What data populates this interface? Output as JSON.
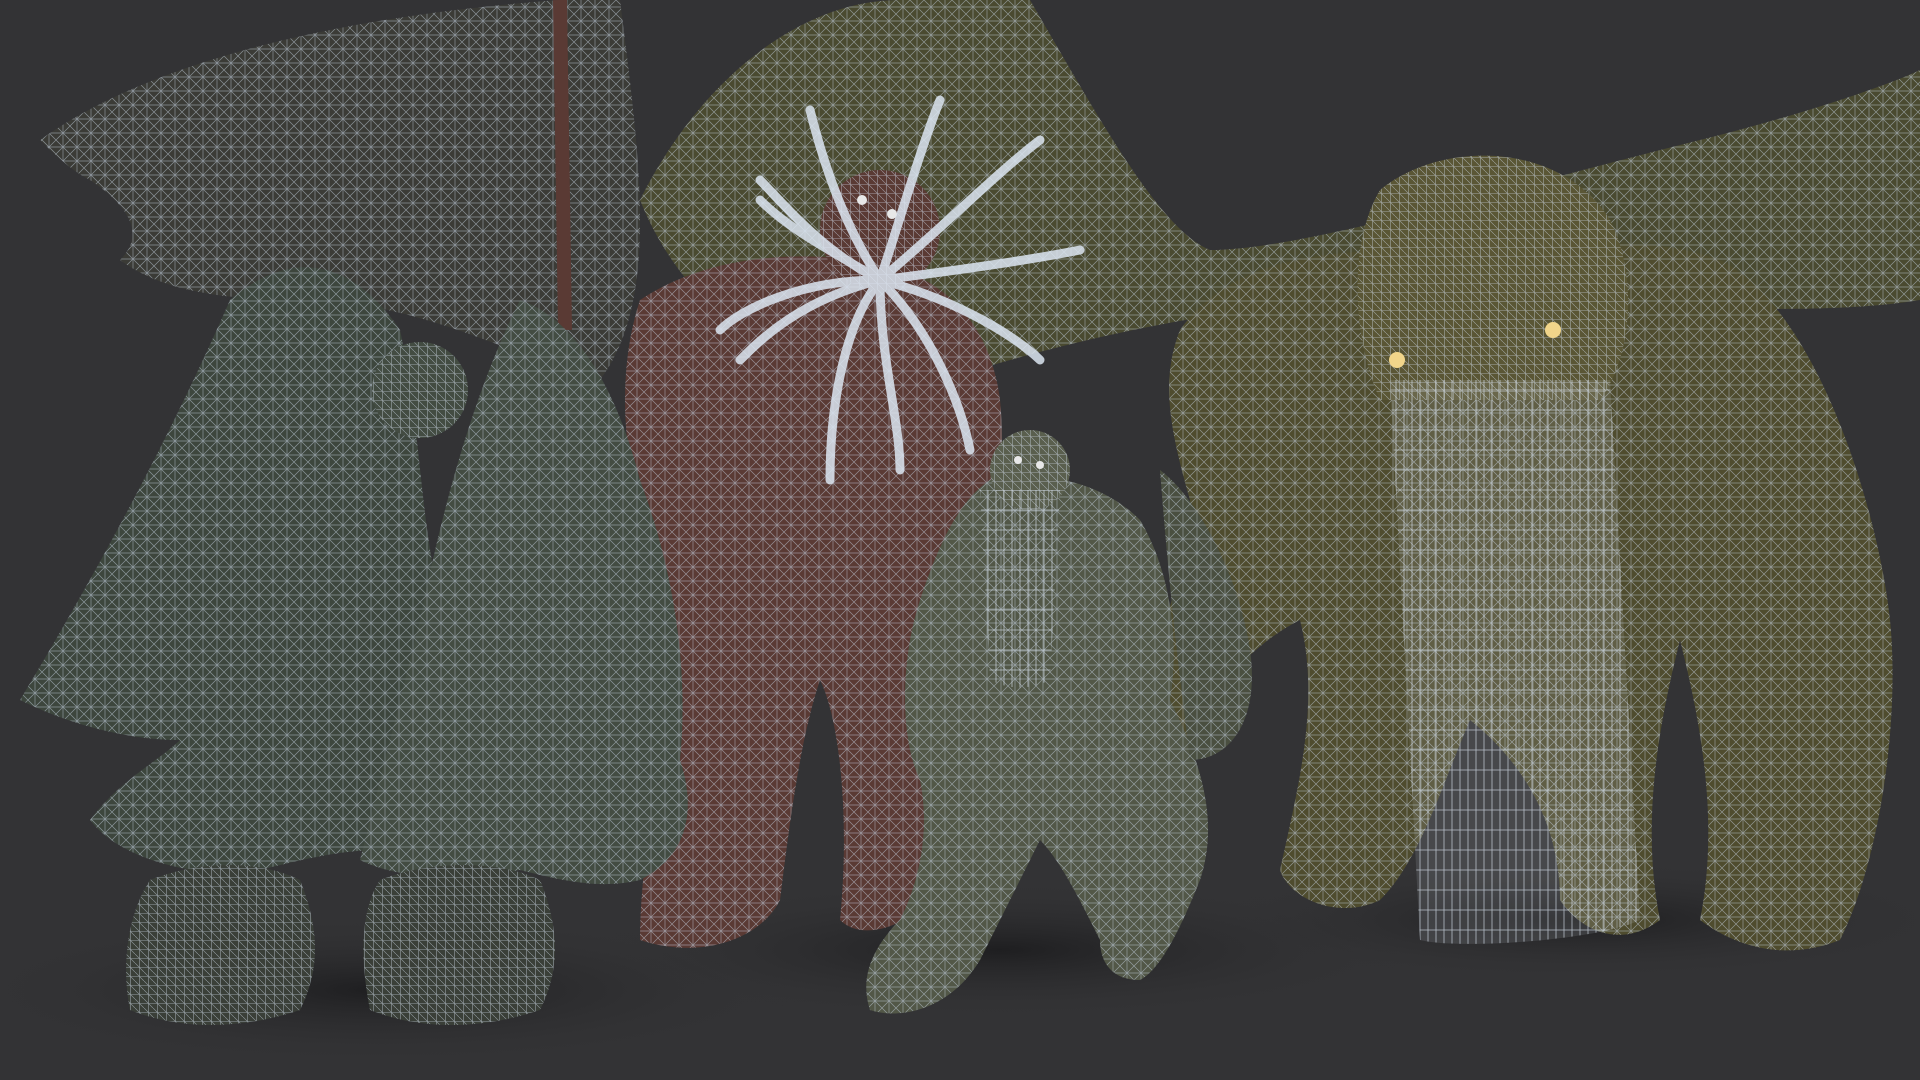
{
  "scene": {
    "description_visible_text": "",
    "background_color": "#333335",
    "floor_shadow_color": "#232325",
    "wire_color": "#c9d6e6",
    "creatures": [
      {
        "name": "winged-hooded-creature-left",
        "body_color": "#3d463d",
        "shade_color": "#2a312b"
      },
      {
        "name": "winged-hooded-creature-right",
        "body_color": "#434c42",
        "shade_color": "#2d342e"
      },
      {
        "name": "red-tentacle-headed-humanoid",
        "body_color": "#5a3a34",
        "shade_color": "#3b2622"
      },
      {
        "name": "crouching-small-tentacle-creature",
        "body_color": "#525747",
        "shade_color": "#383c31"
      },
      {
        "name": "large-tentacle-faced-beast",
        "body_color": "#4f4c2e",
        "shade_color": "#343220",
        "eye_color": "#f1d58a"
      }
    ]
  }
}
